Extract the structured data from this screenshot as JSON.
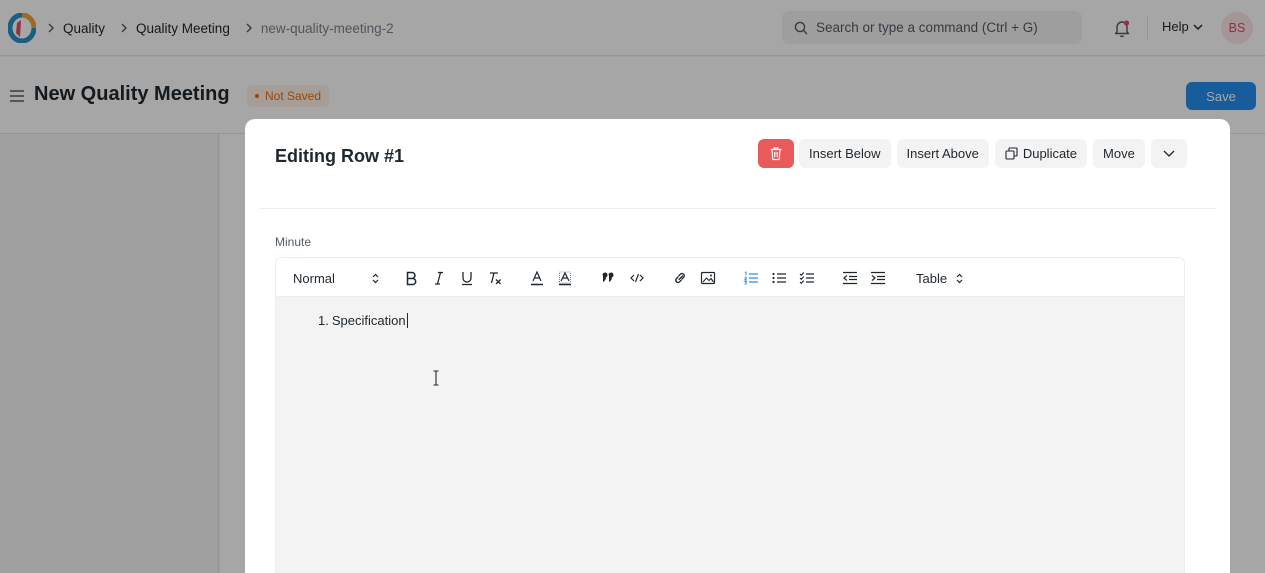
{
  "navbar": {
    "breadcrumbs": [
      "Quality",
      "Quality Meeting",
      "new-quality-meeting-2"
    ],
    "search_placeholder": "Search or type a command (Ctrl + G)",
    "help_label": "Help",
    "avatar_initials": "BS"
  },
  "page": {
    "title": "New Quality Meeting",
    "status": "Not Saved",
    "save_label": "Save"
  },
  "modal": {
    "title": "Editing Row #1",
    "insert_below": "Insert Below",
    "insert_above": "Insert Above",
    "duplicate": "Duplicate",
    "move": "Move",
    "field_label": "Minute",
    "toolbar": {
      "text_style": "Normal",
      "table": "Table"
    },
    "content": {
      "list_number": "1.",
      "list_item": "Specification"
    }
  },
  "colors": {
    "primary": "#2490ef",
    "danger": "#e95a5a",
    "status": "#e86c13"
  }
}
